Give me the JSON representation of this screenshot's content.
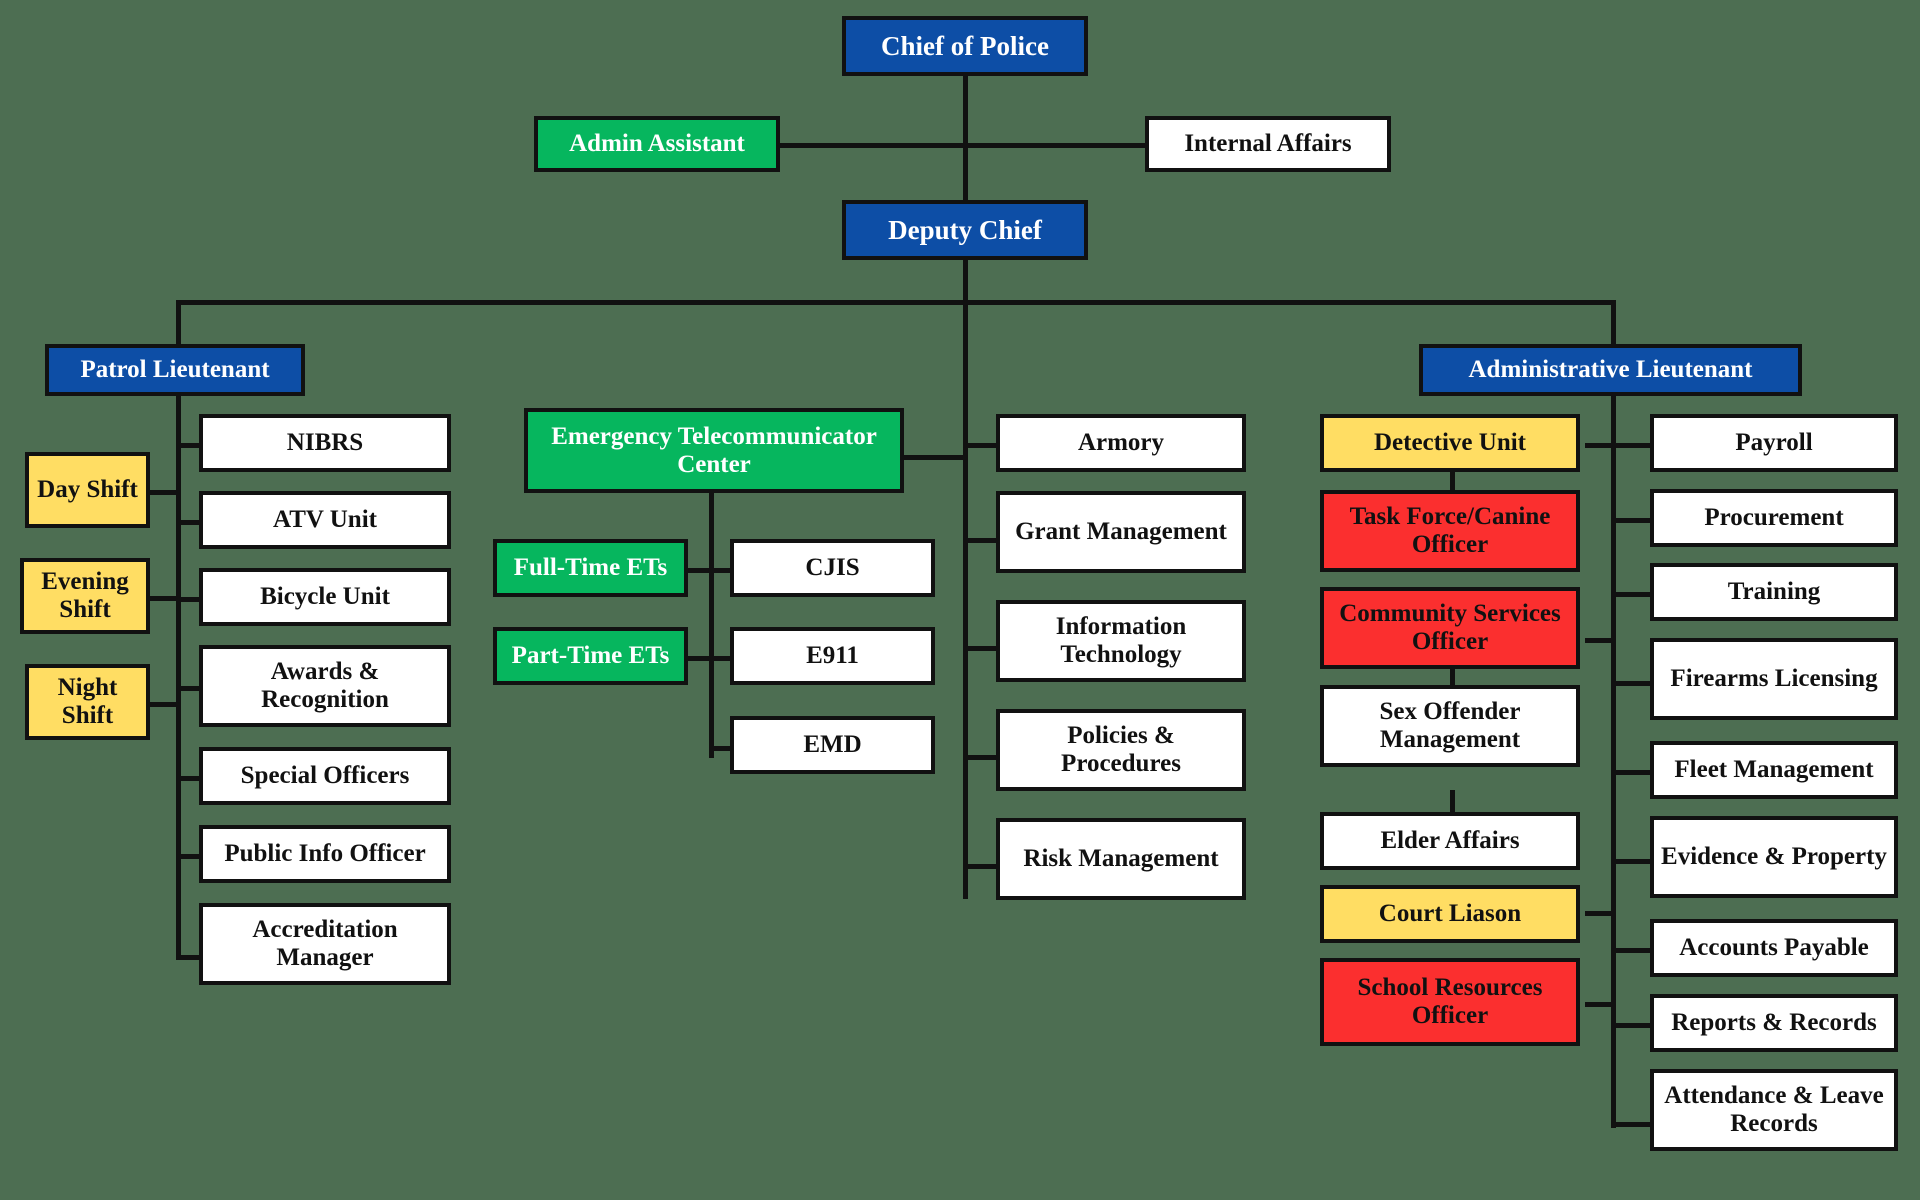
{
  "chart": {
    "title": "Police Department Organizational Chart",
    "background_color": "#4d6e52",
    "line_color": "#111111",
    "palette": {
      "blue": "#0d4ea6",
      "green": "#06b65e",
      "yellow": "#ffdd63",
      "red": "#fb2f2f",
      "white": "#ffffff"
    }
  },
  "nodes": {
    "chief_of_police": "Chief of Police",
    "admin_assistant": "Admin Assistant",
    "internal_affairs": "Internal Affairs",
    "deputy_chief": "Deputy Chief",
    "patrol_lieutenant": "Patrol Lieutenant",
    "administrative_lieutenant": "Administrative Lieutenant",
    "day_shift": "Day Shift",
    "evening_shift": "Evening Shift",
    "night_shift": "Night Shift",
    "nibrs": "NIBRS",
    "atv_unit": "ATV Unit",
    "bicycle_unit": "Bicycle Unit",
    "awards_recognition": "Awards & Recognition",
    "special_officers": "Special Officers",
    "public_info_officer": "Public Info Officer",
    "accreditation_manager": "Accreditation Manager",
    "emergency_telecommunicator_center": "Emergency Telecommunicator Center",
    "full_time_ets": "Full-Time ETs",
    "part_time_ets": "Part-Time ETs",
    "cjis": "CJIS",
    "e911": "E911",
    "emd": "EMD",
    "armory": "Armory",
    "grant_management": "Grant Management",
    "information_technology": "Information Technology",
    "policies_procedures": "Policies & Procedures",
    "risk_management": "Risk Management",
    "detective_unit": "Detective Unit",
    "task_force_canine_officer": "Task Force/Canine Officer",
    "community_services_officer": "Community Services Officer",
    "sex_offender_management": "Sex Offender Management",
    "elder_affairs": "Elder Affairs",
    "court_liason": "Court Liason",
    "school_resources_officer": "School Resources Officer",
    "payroll": "Payroll",
    "procurement": "Procurement",
    "training": "Training",
    "firearms_licensing": "Firearms Licensing",
    "fleet_management": "Fleet Management",
    "evidence_property": "Evidence & Property",
    "accounts_payable": "Accounts Payable",
    "reports_records": "Reports & Records",
    "attendance_leave_records": "Attendance & Leave Records"
  }
}
